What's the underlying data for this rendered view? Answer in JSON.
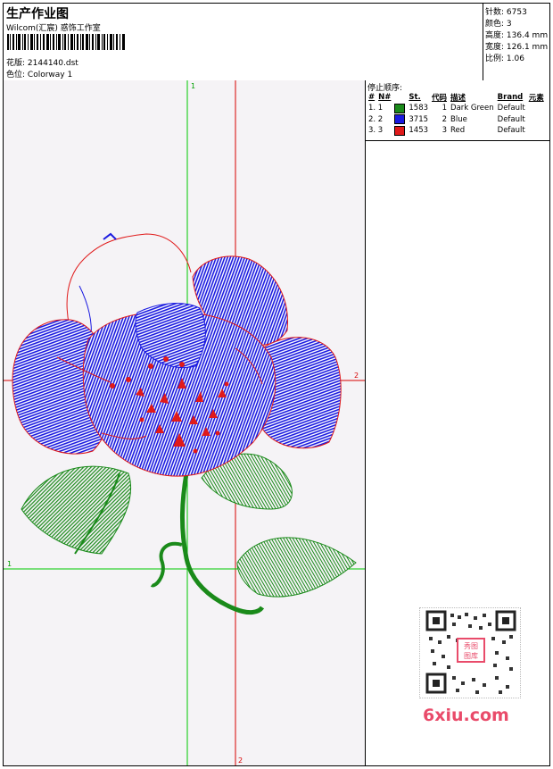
{
  "header": {
    "title": "生产作业图",
    "studio": "Wilcom(汇宸) 惑饰工作室",
    "design_label": "花版:",
    "design_value": "2144140.dst",
    "colorway_label": "色位:",
    "colorway_value": "Colorway 1"
  },
  "stats": [
    {
      "label": "针数:",
      "value": "6753"
    },
    {
      "label": "颜色:",
      "value": "3"
    },
    {
      "label": "高度:",
      "value": "136.4 mm"
    },
    {
      "label": "宽度:",
      "value": "126.1 mm"
    },
    {
      "label": "比例:",
      "value": "1.06"
    }
  ],
  "stop_sequence": {
    "title": "停止顺序:",
    "columns": [
      "#",
      "N#",
      "",
      "St.",
      "代码",
      "描述",
      "Brand",
      "元素"
    ],
    "rows": [
      {
        "index": "1. 1",
        "swatch": "#1a8a1a",
        "stitches": "1583",
        "code": "1",
        "description": "Dark Green",
        "brand": "Default"
      },
      {
        "index": "2. 2",
        "swatch": "#1a1ae0",
        "stitches": "3715",
        "code": "2",
        "description": "Blue",
        "brand": "Default"
      },
      {
        "index": "3. 3",
        "swatch": "#e01a1a",
        "stitches": "1453",
        "code": "3",
        "description": "Red",
        "brand": "Default"
      }
    ]
  },
  "axes": {
    "v1": "1",
    "v2": "2",
    "h2": "2",
    "h1": "1"
  },
  "watermark": "6xiu.com",
  "qr_badge": "秀图 图库",
  "colors": {
    "green_thread": "#1a8a1a",
    "blue_thread": "#1a1ae0",
    "red_thread": "#e01a1a",
    "axis_green": "#00c800",
    "axis_red": "#d80000"
  }
}
